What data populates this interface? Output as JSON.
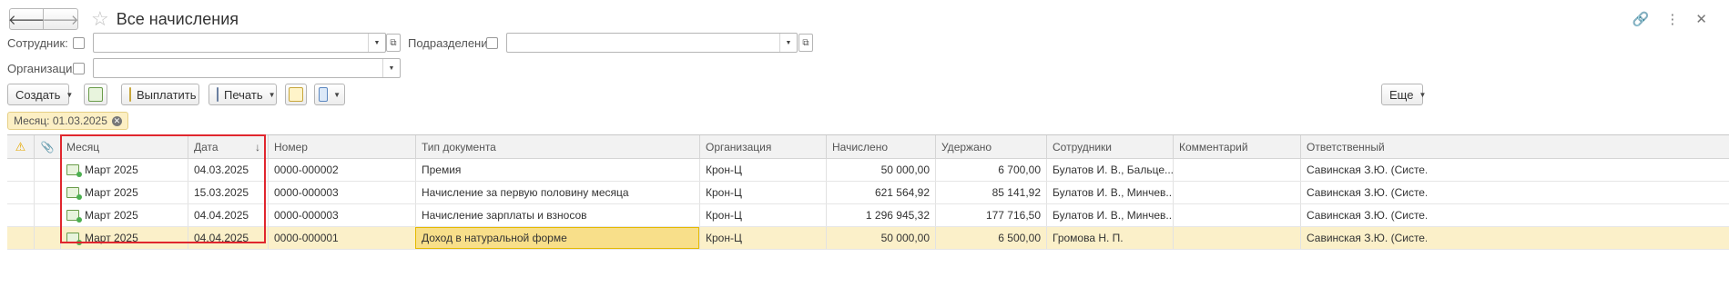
{
  "window": {
    "title": "Все начисления",
    "back_icon": "arrow-left",
    "forward_icon": "arrow-right"
  },
  "filters": {
    "employee_label": "Сотрудник:",
    "employee_value": "",
    "department_label": "Подразделение:",
    "department_value": "",
    "organization_label": "Организация:",
    "organization_value": ""
  },
  "toolbar": {
    "create_label": "Создать",
    "pay_label": "Выплатить",
    "print_label": "Печать",
    "more_label": "Еще"
  },
  "active_filter": {
    "label": "Месяц: 01.03.2025"
  },
  "table": {
    "columns": [
      "Месяц",
      "Дата",
      "Номер",
      "Тип документа",
      "Организация",
      "Начислено",
      "Удержано",
      "Сотрудники",
      "Комментарий",
      "Ответственный"
    ],
    "sort_indicator": "↓",
    "rows": [
      {
        "month": "Март 2025",
        "date": "04.03.2025",
        "number": "0000-000002",
        "doc_type": "Премия",
        "org": "Крон-Ц",
        "accrued": "50 000,00",
        "withheld": "6 700,00",
        "employees": "Булатов И. В., Бальце...",
        "comment": "",
        "responsible": "Савинская З.Ю. (Систе..."
      },
      {
        "month": "Март 2025",
        "date": "15.03.2025",
        "number": "0000-000003",
        "doc_type": "Начисление за первую половину месяца",
        "org": "Крон-Ц",
        "accrued": "621 564,92",
        "withheld": "85 141,92",
        "employees": "Булатов И. В., Минчев...",
        "comment": "",
        "responsible": "Савинская З.Ю. (Систе..."
      },
      {
        "month": "Март 2025",
        "date": "04.04.2025",
        "number": "0000-000003",
        "doc_type": "Начисление зарплаты и взносов",
        "org": "Крон-Ц",
        "accrued": "1 296 945,32",
        "withheld": "177 716,50",
        "employees": "Булатов И. В., Минчев...",
        "comment": "",
        "responsible": "Савинская З.Ю. (Систе..."
      },
      {
        "month": "Март 2025",
        "date": "04.04.2025",
        "number": "0000-000001",
        "doc_type": "Доход в натуральной форме",
        "org": "Крон-Ц",
        "accrued": "50 000,00",
        "withheld": "6 500,00",
        "employees": "Громова Н. П.",
        "comment": "",
        "responsible": "Савинская З.Ю. (Систе..."
      }
    ]
  },
  "colors": {
    "highlight_frame": "#e0262e",
    "selected_row": "#fbf0c9",
    "filter_tag": "#fcefc4"
  }
}
